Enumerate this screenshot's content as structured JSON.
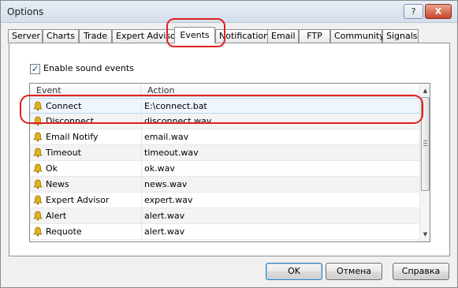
{
  "window": {
    "title": "Options",
    "help_label": "?",
    "close_label": "X"
  },
  "tabs": [
    {
      "label": "Server"
    },
    {
      "label": "Charts"
    },
    {
      "label": "Trade"
    },
    {
      "label": "Expert Advisors"
    },
    {
      "label": "Events",
      "active": true
    },
    {
      "label": "Notifications"
    },
    {
      "label": "Email"
    },
    {
      "label": "FTP"
    },
    {
      "label": "Community"
    },
    {
      "label": "Signals"
    }
  ],
  "events": {
    "enable_sound_label": "Enable sound events",
    "enable_sound_checked": true,
    "columns": [
      "Event",
      "Action"
    ],
    "rows": [
      {
        "event": "Connect",
        "action": "E:\\connect.bat",
        "selected": true
      },
      {
        "event": "Disconnect",
        "action": "disconnect.wav"
      },
      {
        "event": "Email Notify",
        "action": "email.wav"
      },
      {
        "event": "Timeout",
        "action": "timeout.wav"
      },
      {
        "event": "Ok",
        "action": "ok.wav"
      },
      {
        "event": "News",
        "action": "news.wav"
      },
      {
        "event": "Expert Advisor",
        "action": "expert.wav"
      },
      {
        "event": "Alert",
        "action": "alert.wav"
      },
      {
        "event": "Requote",
        "action": "alert.wav"
      }
    ],
    "row_icon": "bell-icon"
  },
  "buttons": {
    "ok_label": "OK",
    "cancel_label": "Отмена",
    "help_label": "Справка"
  },
  "colors": {
    "highlight": "#e02020",
    "selected_row": "#eef5fc",
    "bell": "#e3b11b"
  }
}
